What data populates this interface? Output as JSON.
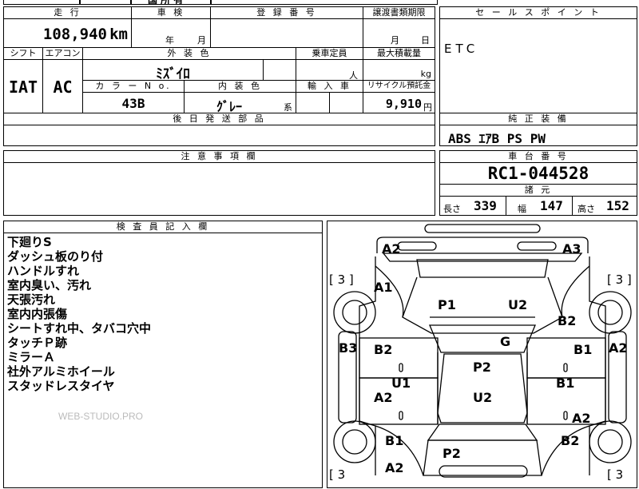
{
  "header_top": {
    "fragment": "国 所 有"
  },
  "mileage": {
    "label": "走 行",
    "value": "108,940",
    "unit": "km"
  },
  "inspection": {
    "label": "車 検",
    "year_unit": "年",
    "month_unit": "月"
  },
  "registration": {
    "label": "登 録 番 号",
    "value": ""
  },
  "transfer_deadline": {
    "label": "譲渡書類期限",
    "month_unit": "月",
    "day_unit": "日"
  },
  "shift": {
    "label": "シフト",
    "value": "IAT"
  },
  "aircon": {
    "label": "エアコン",
    "value": "AC"
  },
  "exterior_color": {
    "label": "外 装 色",
    "value": "ﾐｽﾞｲﾛ"
  },
  "capacity": {
    "label": "乗車定員",
    "unit": "人"
  },
  "max_load": {
    "label": "最大積載量",
    "unit": "kg"
  },
  "color_no": {
    "label": "カ ラ ー N o.",
    "value": "43B"
  },
  "interior_color": {
    "label": "内 装 色",
    "value": "ｸﾞﾚｰ",
    "suffix": "系"
  },
  "import": {
    "label": "輸 入 車"
  },
  "recycle": {
    "label": "リサイクル預託金",
    "value": "9,910",
    "unit": "円"
  },
  "later_parts": {
    "label": "後 日 発 送 部 品"
  },
  "sales_point": {
    "label": "セ ー ル ス ポ イ ン ト",
    "value": "ETC"
  },
  "equipment": {
    "label": "純 正 装 備",
    "value": "ABS ｴｱB PS PW"
  },
  "caution": {
    "label": "注 意 事 項 欄"
  },
  "chassis": {
    "label": "車 台 番 号",
    "value": "RC1-044528"
  },
  "specs": {
    "label": "諸 元",
    "length_label": "長さ",
    "length": "339",
    "width_label": "幅",
    "width": "147",
    "height_label": "高さ",
    "height": "152"
  },
  "inspector": {
    "label": "検 査 員 記 入 欄",
    "notes": [
      "下廻りS",
      "ダッシュ板のり付",
      "ハンドルすれ",
      "室内臭い、汚れ",
      "天張汚れ",
      "室内内張傷",
      "シートすれ中、タバコ穴中",
      "タッチＰ跡",
      "ミラーＡ",
      "社外アルミホイール",
      "スタッドレスタイヤ"
    ]
  },
  "watermark": "WEB-STUDIO.PRO",
  "diagram": {
    "tread_left_top": "[ 3 ]",
    "tread_right_top": "[ 3 ]",
    "tread_left_bottom": "[ 3",
    "tread_right_bottom": "[ 3",
    "marks": {
      "front_bumper_left": "A2",
      "front_bumper_right": "A3",
      "front_fender_left": "A1",
      "hood_left": "P1",
      "hood_right": "U2",
      "front_fender_right": "B2",
      "windshield": "G",
      "side_rail_left": "B3",
      "side_rail_right": "A2",
      "front_door_left": "B2",
      "front_door_right": "B1",
      "roof_top": "P2",
      "roof_bottom": "U2",
      "pillar_left": "U1",
      "pillar_right": "B1",
      "rear_door_left": "A2",
      "rear_door_right": "A2",
      "rear_fender_left": "B1",
      "rear_fender_right": "B2",
      "trunk": "P2",
      "rear_bumper_left": "A2"
    }
  }
}
